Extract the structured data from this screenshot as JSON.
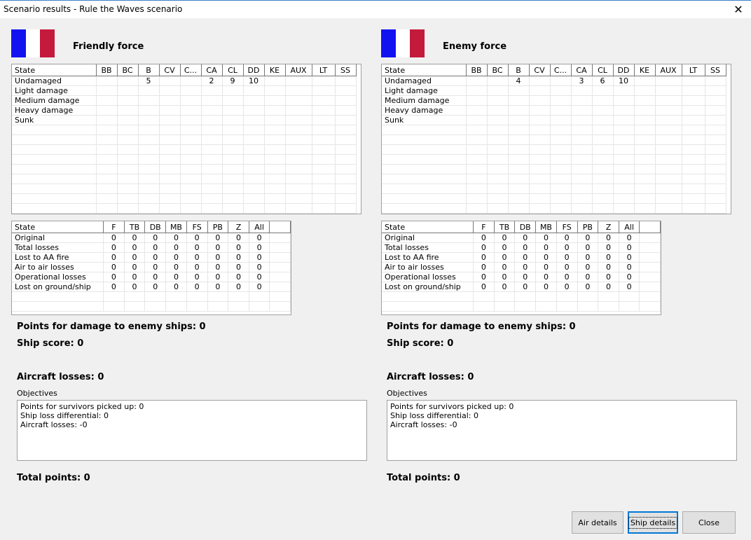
{
  "window": {
    "title": "Scenario results - Rule the Waves scenario",
    "close_glyph": "✕"
  },
  "ship_columns": [
    "State",
    "BB",
    "BC",
    "B",
    "CV",
    "C...",
    "CA",
    "CL",
    "DD",
    "KE",
    "AUX",
    "LT",
    "SS"
  ],
  "air_columns": [
    "State",
    "F",
    "TB",
    "DB",
    "MB",
    "FS",
    "PB",
    "Z",
    "All"
  ],
  "labels": {
    "damage_points": "Points for damage to enemy ships: 0",
    "ship_score": "Ship score: 0",
    "aircraft_losses": "Aircraft losses: 0",
    "objectives": "Objectives",
    "total_points": "Total points: 0"
  },
  "friendly": {
    "title": "Friendly force",
    "flag_colors": [
      "#1212f0",
      "#ffffff",
      "#c41a3c"
    ],
    "ship_rows": [
      [
        "Undamaged",
        "",
        "",
        "5",
        "",
        "",
        "2",
        "9",
        "10",
        "",
        "",
        "",
        ""
      ],
      [
        "Light damage",
        "",
        "",
        "",
        "",
        "",
        "",
        "",
        "",
        "",
        "",
        "",
        ""
      ],
      [
        "Medium damage",
        "",
        "",
        "",
        "",
        "",
        "",
        "",
        "",
        "",
        "",
        "",
        ""
      ],
      [
        "Heavy damage",
        "",
        "",
        "",
        "",
        "",
        "",
        "",
        "",
        "",
        "",
        "",
        ""
      ],
      [
        "Sunk",
        "",
        "",
        "",
        "",
        "",
        "",
        "",
        "",
        "",
        "",
        "",
        ""
      ]
    ],
    "air_rows": [
      [
        "Original",
        "0",
        "0",
        "0",
        "0",
        "0",
        "0",
        "0",
        "0"
      ],
      [
        "Total losses",
        "0",
        "0",
        "0",
        "0",
        "0",
        "0",
        "0",
        "0"
      ],
      [
        "Lost to AA fire",
        "0",
        "0",
        "0",
        "0",
        "0",
        "0",
        "0",
        "0"
      ],
      [
        "Air to air losses",
        "0",
        "0",
        "0",
        "0",
        "0",
        "0",
        "0",
        "0"
      ],
      [
        "Operational losses",
        "0",
        "0",
        "0",
        "0",
        "0",
        "0",
        "0",
        "0"
      ],
      [
        "Lost on ground/ship",
        "0",
        "0",
        "0",
        "0",
        "0",
        "0",
        "0",
        "0"
      ]
    ],
    "objectives_lines": [
      "Points for survivors picked up: 0",
      "Ship loss differential: 0",
      "Aircraft losses: -0"
    ]
  },
  "enemy": {
    "title": "Enemy force",
    "flag_colors": [
      "#1212f0",
      "#ffffff",
      "#c41a3c"
    ],
    "ship_rows": [
      [
        "Undamaged",
        "",
        "",
        "4",
        "",
        "",
        "3",
        "6",
        "10",
        "",
        "",
        "",
        ""
      ],
      [
        "Light damage",
        "",
        "",
        "",
        "",
        "",
        "",
        "",
        "",
        "",
        "",
        "",
        ""
      ],
      [
        "Medium damage",
        "",
        "",
        "",
        "",
        "",
        "",
        "",
        "",
        "",
        "",
        "",
        ""
      ],
      [
        "Heavy damage",
        "",
        "",
        "",
        "",
        "",
        "",
        "",
        "",
        "",
        "",
        "",
        ""
      ],
      [
        "Sunk",
        "",
        "",
        "",
        "",
        "",
        "",
        "",
        "",
        "",
        "",
        "",
        ""
      ]
    ],
    "air_rows": [
      [
        "Original",
        "0",
        "0",
        "0",
        "0",
        "0",
        "0",
        "0",
        "0"
      ],
      [
        "Total losses",
        "0",
        "0",
        "0",
        "0",
        "0",
        "0",
        "0",
        "0"
      ],
      [
        "Lost to AA fire",
        "0",
        "0",
        "0",
        "0",
        "0",
        "0",
        "0",
        "0"
      ],
      [
        "Air to air losses",
        "0",
        "0",
        "0",
        "0",
        "0",
        "0",
        "0",
        "0"
      ],
      [
        "Operational losses",
        "0",
        "0",
        "0",
        "0",
        "0",
        "0",
        "0",
        "0"
      ],
      [
        "Lost on ground/ship",
        "0",
        "0",
        "0",
        "0",
        "0",
        "0",
        "0",
        "0"
      ]
    ],
    "objectives_lines": [
      "Points for survivors picked up: 0",
      "Ship loss differential: 0",
      "Aircraft losses: -0"
    ]
  },
  "buttons": {
    "air_details": "Air details",
    "ship_details": "Ship details",
    "close": "Close"
  }
}
